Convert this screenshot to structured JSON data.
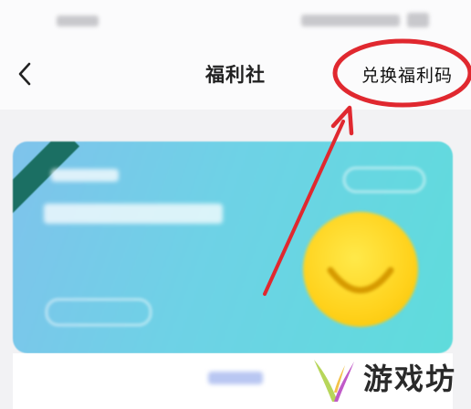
{
  "header": {
    "title": "福利社",
    "redeem_label": "兑换福利码"
  },
  "watermark": {
    "text": "游戏坊"
  },
  "colors": {
    "annotation_red": "#e0282f",
    "card_gradient_start": "#7fc3ec",
    "card_gradient_end": "#5fdcdc",
    "smiley_yellow": "#ffd21c",
    "corner_tag_green": "#1b6f63"
  },
  "icons": [
    "back-chevron-icon",
    "smiley-icon",
    "watermark-logo-icon"
  ]
}
